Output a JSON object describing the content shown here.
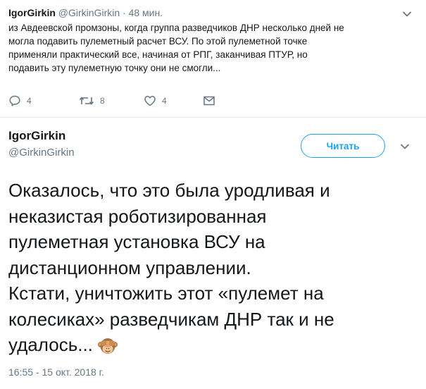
{
  "tweet1": {
    "name": "IgorGirkin",
    "handle": "@GirkinGirkin",
    "separator": "·",
    "time": "48 мин.",
    "lines": [
      "из Авдеевской промзоны, когда группа разведчиков ДНР несколько дней не",
      "могла подавить пулеметный расчет ВСУ. По этой пулеметной точке",
      "применяли практический все, начиная от РПГ, заканчивая ПТУР, но",
      "подавить эту пулеметную точку они не смогли..."
    ],
    "replies": "4",
    "retweets": "8",
    "likes": "4"
  },
  "tweet2": {
    "name": "IgorGirkin",
    "handle": "@GirkinGirkin",
    "follow_label": "Читать",
    "lines": [
      "Оказалось, что это была уродливая и",
      "неказистая роботизированная",
      "пулеметная установка ВСУ на",
      "дистанционном управлении.",
      "Кстати, уничтожить этот «пулемет на",
      "колесиках» разведчикам ДНР так и не",
      "удалось..."
    ],
    "emoji": "see-no-evil-monkey-icon",
    "date": "16:55 - 15 окт. 2018 г."
  },
  "colors": {
    "text": "#14171a",
    "secondary": "#657786",
    "accent": "#1da1f2",
    "divider": "#e6ecf0"
  }
}
